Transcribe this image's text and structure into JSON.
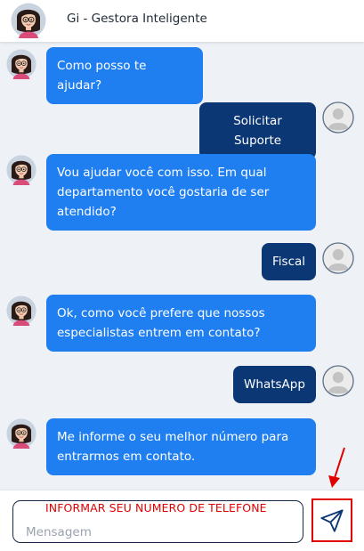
{
  "header": {
    "title": "Gi - Gestora Inteligente",
    "avatar_icon": "assistant-avatar"
  },
  "messages": [
    {
      "from": "bot",
      "lines": [
        "Como posso te ajudar?"
      ]
    },
    {
      "from": "user",
      "lines": [
        "Solicitar Suporte"
      ]
    },
    {
      "from": "bot",
      "lines": [
        "Vou ajudar você com isso. Em qual",
        "departamento você gostaria de ser",
        "atendido?"
      ]
    },
    {
      "from": "user",
      "lines": [
        "Fiscal"
      ]
    },
    {
      "from": "bot",
      "lines": [
        "Ok, como você prefere que nossos",
        "especialistas entrem em contato?"
      ]
    },
    {
      "from": "user",
      "lines": [
        "WhatsApp"
      ]
    },
    {
      "from": "bot",
      "lines": [
        "Me informe o seu melhor número para",
        "entrarmos em contato."
      ]
    }
  ],
  "composer": {
    "placeholder": "Mensagem",
    "annotation": "INFORMAR SEU NUMERO DE TELEFONE",
    "send_icon": "send-icon"
  },
  "colors": {
    "bot_bubble": "#1f7ef0",
    "user_bubble": "#0c3775",
    "annotation": "#e10000",
    "background": "#eef2f7"
  }
}
